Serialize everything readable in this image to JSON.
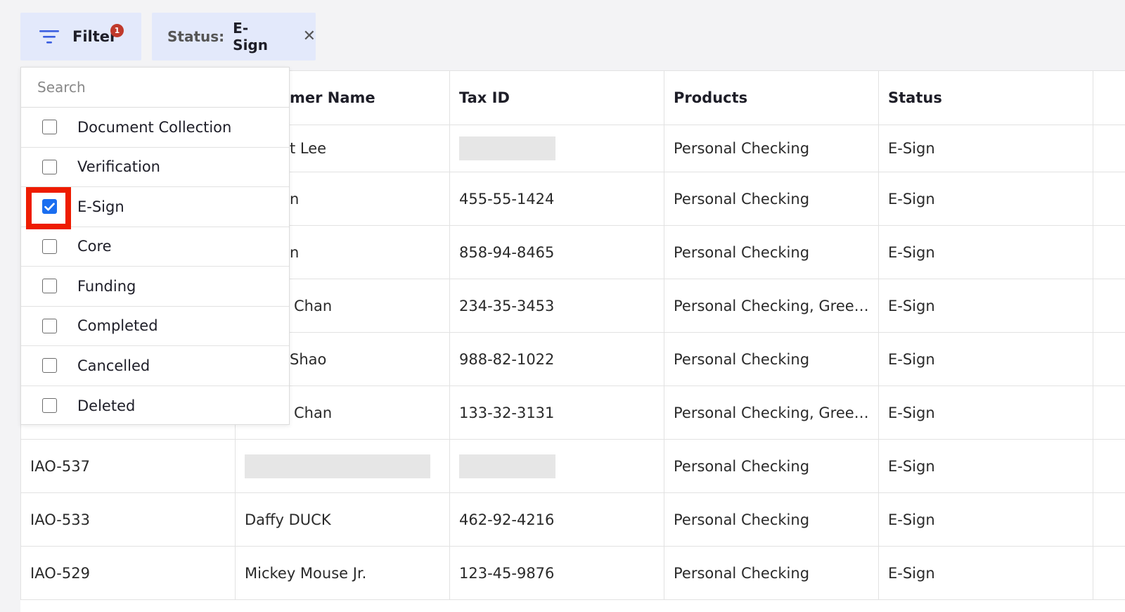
{
  "filter": {
    "label": "Filter",
    "badge": "1",
    "chip_key": "Status:",
    "chip_value": "E-Sign",
    "chip_close": "✕"
  },
  "dropdown": {
    "search_placeholder": "Search",
    "options": [
      {
        "label": "Document Collection",
        "checked": false
      },
      {
        "label": "Verification",
        "checked": false
      },
      {
        "label": "E-Sign",
        "checked": true
      },
      {
        "label": "Core",
        "checked": false
      },
      {
        "label": "Funding",
        "checked": false
      },
      {
        "label": "Completed",
        "checked": false
      },
      {
        "label": "Cancelled",
        "checked": false
      },
      {
        "label": "Deleted",
        "checked": false
      }
    ]
  },
  "table": {
    "headers": [
      "",
      "mer Name",
      "Tax ID",
      "Products",
      "Status",
      ""
    ],
    "rows": [
      [
        "",
        "t Lee",
        "",
        "Personal Checking",
        "E-Sign",
        ""
      ],
      [
        "",
        "n",
        "455-55-1424",
        "Personal Checking",
        "E-Sign",
        ""
      ],
      [
        "",
        "n",
        "858-94-8465",
        "Personal Checking",
        "E-Sign",
        ""
      ],
      [
        "",
        "Chan",
        "234-35-3453",
        "Personal Checking, Green ...",
        "E-Sign",
        ""
      ],
      [
        "",
        "Shao",
        "988-82-1022",
        "Personal Checking",
        "E-Sign",
        ""
      ],
      [
        "",
        "Chan",
        "133-32-3131",
        "Personal Checking, Green ...",
        "E-Sign",
        ""
      ],
      [
        "IAO-537",
        "",
        "",
        "Personal Checking",
        "E-Sign",
        ""
      ],
      [
        "IAO-533",
        "Daffy DUCK",
        "462-92-4216",
        "Personal Checking",
        "E-Sign",
        ""
      ],
      [
        "IAO-529",
        "Mickey Mouse Jr.",
        "123-45-9876",
        "Personal Checking",
        "E-Sign",
        ""
      ]
    ]
  },
  "colors": {
    "accent": "#1a6ef0",
    "chip_bg": "#e3e9fb",
    "badge": "#c0392b",
    "highlight": "#ee1c00"
  }
}
